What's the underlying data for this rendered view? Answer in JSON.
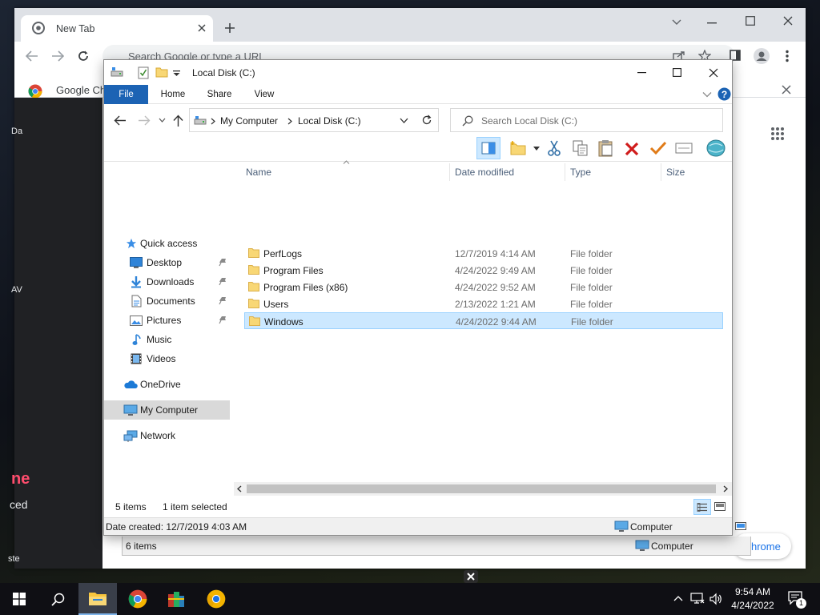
{
  "chrome": {
    "tab_title": "New Tab",
    "omnibox_placeholder": "Search Google or type a URL",
    "bookmark_label": "Google Ch",
    "side_labels": [
      "Da",
      "AV"
    ],
    "side_red": "ne",
    "side_ced": "ced",
    "side_ste": "ste",
    "bg_button": "hrome"
  },
  "explorer": {
    "title": "Local Disk (C:)",
    "ribbon_tabs": [
      "File",
      "Home",
      "Share",
      "View"
    ],
    "address": {
      "root": "My Computer",
      "current": "Local Disk (C:)"
    },
    "search_placeholder": "Search Local Disk (C:)",
    "nav": {
      "quick_access": "Quick access",
      "desktop": "Desktop",
      "downloads": "Downloads",
      "documents": "Documents",
      "pictures": "Pictures",
      "music": "Music",
      "videos": "Videos",
      "onedrive": "OneDrive",
      "my_computer": "My Computer",
      "network": "Network"
    },
    "columns": {
      "name": "Name",
      "date": "Date modified",
      "type": "Type",
      "size": "Size"
    },
    "files": [
      {
        "name": "PerfLogs",
        "date": "12/7/2019 4:14 AM",
        "type": "File folder"
      },
      {
        "name": "Program Files",
        "date": "4/24/2022 9:49 AM",
        "type": "File folder"
      },
      {
        "name": "Program Files (x86)",
        "date": "4/24/2022 9:52 AM",
        "type": "File folder"
      },
      {
        "name": "Users",
        "date": "2/13/2022 1:21 AM",
        "type": "File folder"
      },
      {
        "name": "Windows",
        "date": "4/24/2022 9:44 AM",
        "type": "File folder"
      }
    ],
    "status": {
      "items": "5 items",
      "selected": "1 item selected"
    },
    "details": {
      "date_created": "Date created: 12/7/2019 4:03 AM",
      "location": "Computer"
    }
  },
  "background_window": {
    "items": "6 items",
    "location": "Computer"
  },
  "taskbar": {
    "time": "9:54 AM",
    "date": "4/24/2022",
    "notifications": "1"
  },
  "colors": {
    "accent": "#1c63b4",
    "selection": "#cce8ff",
    "folder": "#f8d775"
  }
}
